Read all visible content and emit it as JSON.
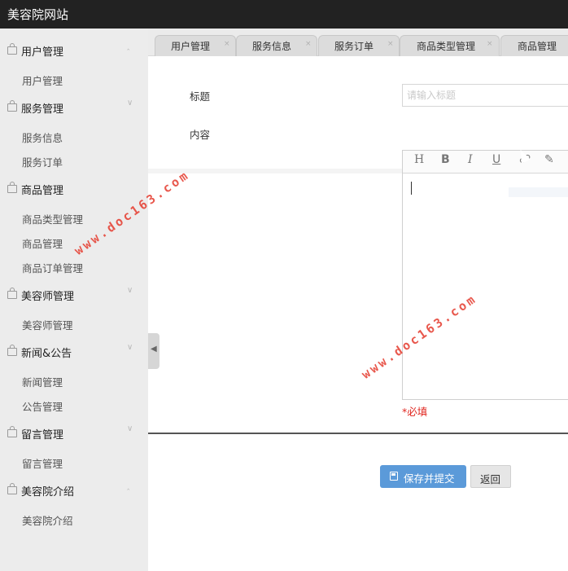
{
  "app": {
    "title": "美容院网站"
  },
  "sidebar": {
    "groups": [
      {
        "label": "用户管理",
        "items": [
          "用户管理"
        ]
      },
      {
        "label": "服务管理",
        "items": [
          "服务信息",
          "服务订单"
        ]
      },
      {
        "label": "商品管理",
        "items": [
          "商品类型管理",
          "商品管理",
          "商品订单管理"
        ]
      },
      {
        "label": "美容师管理",
        "items": [
          "美容师管理"
        ]
      },
      {
        "label": "新闻&公告",
        "items": [
          "新闻管理",
          "公告管理"
        ]
      },
      {
        "label": "留言管理",
        "items": [
          "留言管理"
        ]
      },
      {
        "label": "美容院介绍",
        "items": [
          "美容院介绍"
        ]
      }
    ]
  },
  "tabs": [
    {
      "label": "用户管理",
      "close": "×"
    },
    {
      "label": "服务信息",
      "close": "×"
    },
    {
      "label": "服务订单",
      "close": "×"
    },
    {
      "label": "商品类型管理",
      "close": "×"
    },
    {
      "label": "商品管理",
      "close": ""
    }
  ],
  "form": {
    "title_label": "标题",
    "title_value": "",
    "title_placeholder": "请输入标题",
    "content_label": "内容",
    "required_hint": "*必填",
    "editor_tools": [
      "H",
      "B",
      "I",
      "U",
      "link-icon",
      "pencil-icon"
    ]
  },
  "actions": {
    "save_label": "保存并提交",
    "back_label": "返回"
  },
  "watermark": "www.doc163.com",
  "colors": {
    "topbar": "#222222",
    "sidebar": "#ececec",
    "primary_button": "#5b9ad9",
    "required": "#e0261f"
  }
}
